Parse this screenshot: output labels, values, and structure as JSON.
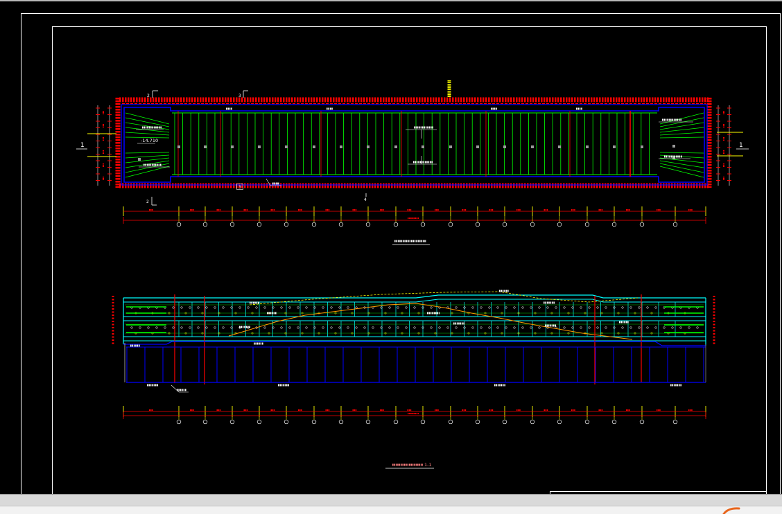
{
  "colors": {
    "background": "#000000",
    "label": "#ffffff",
    "pile": "#ff0000",
    "wall": "#0000ff",
    "strut": "#00ff00",
    "slab": "#00ffff",
    "axis": "#ffff00",
    "slope": "#ff9900",
    "title": "#ff8080",
    "marker": "#9a9a9a",
    "statusbar": "#d9d9d9",
    "logo": "#e8651c"
  },
  "plan": {
    "elevation": "-14.710",
    "section_mark_left": "1",
    "section_mark_right": "1",
    "cut_marks": [
      "2",
      "3",
      "2",
      "3",
      "4"
    ]
  },
  "section": {
    "title_number": "1-1"
  },
  "status_bar": {
    "icon": "orange-logo-icon"
  }
}
